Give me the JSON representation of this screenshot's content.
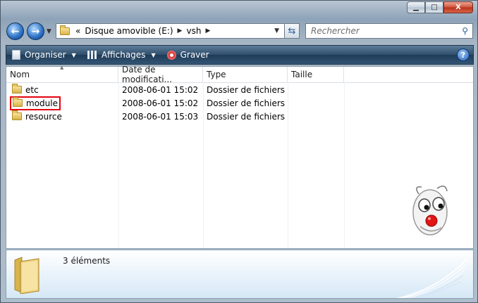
{
  "window": {
    "caption_buttons": {
      "minimize": "▁",
      "maximize": "□",
      "close": "X"
    }
  },
  "address_bar": {
    "overflow": "«",
    "segments": [
      "Disque amovible (E:)",
      "vsh"
    ]
  },
  "search": {
    "placeholder": "Rechercher"
  },
  "toolbar": {
    "organize": "Organiser",
    "views": "Affichages",
    "burn": "Graver",
    "help": "?"
  },
  "columns": [
    "Nom",
    "Date de modificati...",
    "Type",
    "Taille"
  ],
  "files": [
    {
      "name": "etc",
      "date": "2008-06-01 15:02",
      "type": "Dossier de fichiers",
      "size": ""
    },
    {
      "name": "module",
      "date": "2008-06-01 15:02",
      "type": "Dossier de fichiers",
      "size": "",
      "highlighted": true
    },
    {
      "name": "resource",
      "date": "2008-06-01 15:03",
      "type": "Dossier de fichiers",
      "size": ""
    }
  ],
  "details_pane": {
    "item_count": "3 éléments"
  },
  "colors": {
    "highlight_border": "#e60012",
    "toolbar_dark": "#2f4e6c"
  },
  "icons": [
    "folder-icon",
    "back-arrow-icon",
    "forward-arrow-icon",
    "refresh-icon",
    "search-icon",
    "help-icon",
    "clown-face-icon"
  ]
}
